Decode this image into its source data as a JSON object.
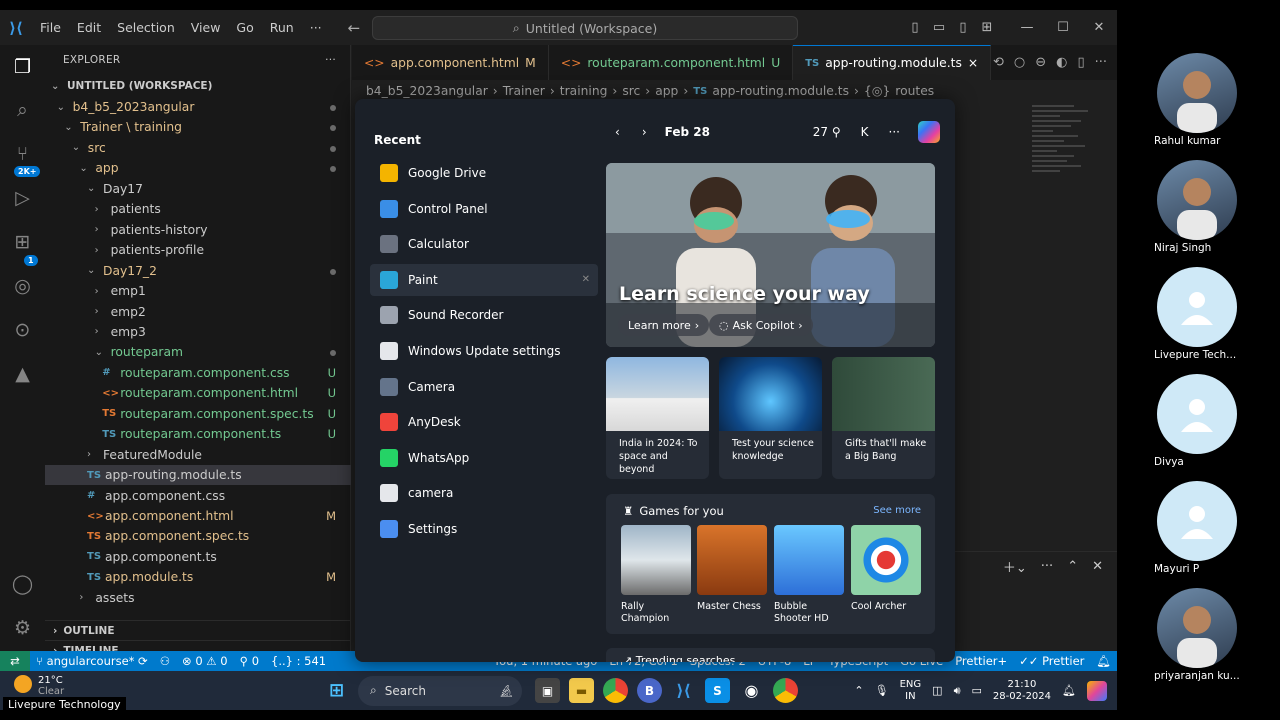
{
  "titlebar": {
    "menu": [
      "File",
      "Edit",
      "Selection",
      "View",
      "Go",
      "Run",
      "···"
    ],
    "search": "Untitled (Workspace)"
  },
  "activity": {
    "scm_badge": "2K+",
    "ext_badge": "1"
  },
  "explorer": {
    "header": "EXPLORER",
    "workspace": "UNTITLED (WORKSPACE)",
    "tree": [
      {
        "label": "b4_b5_2023angular",
        "status": "dot"
      },
      {
        "label": "Trainer \\ training",
        "status": "dot"
      },
      {
        "label": "src",
        "status": "dot"
      },
      {
        "label": "app",
        "status": "dot"
      },
      {
        "label": "Day17",
        "status": ""
      },
      {
        "label": "patients",
        "status": ""
      },
      {
        "label": "patients-history",
        "status": ""
      },
      {
        "label": "patients-profile",
        "status": ""
      },
      {
        "label": "Day17_2",
        "status": "dot"
      },
      {
        "label": "emp1",
        "status": ""
      },
      {
        "label": "emp2",
        "status": ""
      },
      {
        "label": "emp3",
        "status": ""
      },
      {
        "label": "routeparam",
        "status": "dot"
      },
      {
        "label": "routeparam.component.css",
        "icon": "#",
        "status": "U"
      },
      {
        "label": "routeparam.component.html",
        "icon": "<>",
        "status": "U"
      },
      {
        "label": "routeparam.component.spec.ts",
        "icon": "TS",
        "status": "U"
      },
      {
        "label": "routeparam.component.ts",
        "icon": "TS",
        "status": "U"
      },
      {
        "label": "FeaturedModule",
        "status": ""
      },
      {
        "label": "app-routing.module.ts",
        "icon": "TS",
        "status": ""
      },
      {
        "label": "app.component.css",
        "icon": "#",
        "status": ""
      },
      {
        "label": "app.component.html",
        "icon": "<>",
        "status": "M"
      },
      {
        "label": "app.component.spec.ts",
        "icon": "TS",
        "status": ""
      },
      {
        "label": "app.component.ts",
        "icon": "TS",
        "status": ""
      },
      {
        "label": "app.module.ts",
        "icon": "TS",
        "status": "M"
      },
      {
        "label": "assets",
        "status": ""
      }
    ],
    "outline": "OUTLINE",
    "timeline": "TIMELINE"
  },
  "tabs": [
    {
      "label": "app.component.html",
      "icon": "<>",
      "status": "M"
    },
    {
      "label": "routeparam.component.html",
      "icon": "<>",
      "status": "U"
    },
    {
      "label": "app-routing.module.ts",
      "icon": "TS",
      "status": "×"
    }
  ],
  "breadcrumb": [
    "b4_b5_2023angular",
    "Trainer",
    "training",
    "src",
    "app",
    "app-routing.module.ts",
    "routes"
  ],
  "statusbar": {
    "branch": "angularcourse*",
    "problems": "0",
    "warnings": "0",
    "ports": "0",
    "selection": "{..} : 541",
    "git_blame": "You, 1 minute ago",
    "position": "Ln 72, Col 1",
    "spaces": "Spaces: 2",
    "encoding": "UTF-8",
    "eol": "LF",
    "language": "TypeScript",
    "golive": "Go Live",
    "prettier1": "Prettier+",
    "prettier2": "Prettier"
  },
  "startmenu": {
    "recent_title": "Recent",
    "recent": [
      {
        "label": "Google Drive",
        "color": "#f4b400"
      },
      {
        "label": "Control Panel",
        "color": "#3a8ee6"
      },
      {
        "label": "Calculator",
        "color": "#6b7280"
      },
      {
        "label": "Paint",
        "color": "#2aa6d8"
      },
      {
        "label": "Sound Recorder",
        "color": "#9ca3af"
      },
      {
        "label": "Windows Update settings",
        "color": "#e5e7eb"
      },
      {
        "label": "Camera",
        "color": "#64748b"
      },
      {
        "label": "AnyDesk",
        "color": "#ef443b"
      },
      {
        "label": "WhatsApp",
        "color": "#25d366"
      },
      {
        "label": "camera",
        "color": "#e5e7eb"
      },
      {
        "label": "Settings",
        "color": "#4b8ef0"
      }
    ],
    "date": "Feb 28",
    "temp": "27",
    "avatar_letter": "K",
    "hero_title": "Learn science your way",
    "hero_btn1": "Learn more",
    "hero_btn2": "Ask Copilot",
    "cards": [
      {
        "caption": "India in 2024: To space and beyond"
      },
      {
        "caption": "Test your science knowledge"
      },
      {
        "caption": "Gifts that'll make a Big Bang"
      }
    ],
    "games_title": "Games for you",
    "see_more": "See more",
    "games": [
      "Rally Champion",
      "Master Chess",
      "Bubble Shooter HD",
      "Cool Archer"
    ],
    "trending": "Trending searches"
  },
  "taskbar": {
    "weather_temp": "21°C",
    "weather_desc": "Clear",
    "search": "Search",
    "lang1": "ENG",
    "lang2": "IN",
    "time": "21:10",
    "date": "28-02-2024"
  },
  "participants": [
    {
      "name": "Rahul kumar",
      "type": "photo"
    },
    {
      "name": "Niraj Singh",
      "type": "photo"
    },
    {
      "name": "Livepure Tech...",
      "type": "default"
    },
    {
      "name": "Divya",
      "type": "default"
    },
    {
      "name": "Mayuri P",
      "type": "default"
    },
    {
      "name": "priyaranjan ku...",
      "type": "photo"
    }
  ],
  "watermark": "Livepure Technology"
}
